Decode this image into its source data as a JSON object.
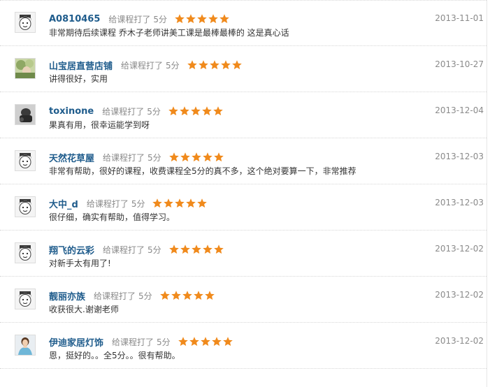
{
  "action_text": "给课程打了",
  "colors": {
    "name": "#1f5c8c",
    "star": "#f08a1c",
    "muted": "#8a8a8a",
    "text": "#333333"
  },
  "reviews": [
    {
      "name": "A0810465",
      "score": "5分",
      "stars": 5,
      "comment": "非常期待后续课程 乔木子老师讲美工课是最棒最棒的 这是真心话",
      "date": "2013-11-01",
      "avatar": "cartoon"
    },
    {
      "name": "山宝居直营店铺",
      "score": "5分",
      "stars": 5,
      "comment": "讲得很好，实用",
      "date": "2013-10-27",
      "avatar": "photo-green"
    },
    {
      "name": "toxinone",
      "score": "5分",
      "stars": 5,
      "comment": "果真有用，很幸运能学到呀",
      "date": "2013-12-04",
      "avatar": "photo-dark"
    },
    {
      "name": "天然花草屋",
      "score": "5分",
      "stars": 5,
      "comment": "非常有帮助，很好的课程，收费课程全5分的真不多，这个绝对要算一下，非常推荐",
      "date": "2013-12-03",
      "avatar": "cartoon"
    },
    {
      "name": "大中_d",
      "score": "5分",
      "stars": 5,
      "comment": "很仔细，确实有帮助，值得学习。",
      "date": "2013-12-03",
      "avatar": "cartoon"
    },
    {
      "name": "翔飞的云彩",
      "score": "5分",
      "stars": 5,
      "comment": "对新手太有用了!",
      "date": "2013-12-02",
      "avatar": "cartoon"
    },
    {
      "name": "靓丽亦族",
      "score": "5分",
      "stars": 5,
      "comment": "收获很大.谢谢老师",
      "date": "2013-12-02",
      "avatar": "cartoon"
    },
    {
      "name": "伊迪家居灯饰",
      "score": "5分",
      "stars": 5,
      "comment": "恩，挺好的。。全5分。。很有帮助。",
      "date": "2013-12-02",
      "avatar": "photo-person"
    }
  ]
}
